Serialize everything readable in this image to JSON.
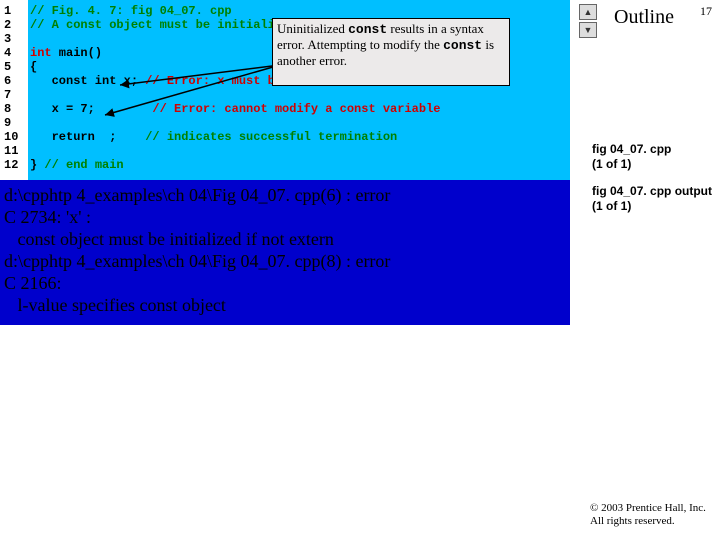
{
  "page_number": "17",
  "outline_title": "Outline",
  "nav": {
    "prev": "▲",
    "next": "▼"
  },
  "line_numbers": "1\n2\n3\n4\n5\n6\n7\n8\n9\n10\n11\n12",
  "code": {
    "l1": "// Fig. 4. 7: fig 04_07. cpp",
    "l2": "// A const object must be initialized",
    "l3": "",
    "l4_intmain": "int",
    "l4_main": " main()",
    "l5": "{",
    "l6_pre": "   const int x; ",
    "l6_err": "// Error: x must be initialized",
    "l7": "",
    "l8_pre": "   x = 7;        ",
    "l8_err": "// Error: cannot modify a const variable",
    "l9": "",
    "l10_pre": "   return  ;    ",
    "l10_note": "// indicates successful termination",
    "l11": "",
    "l12": "} ",
    "l12_note": "// end main"
  },
  "callout": {
    "part1": "Uninitialized ",
    "const1": "const",
    "part2": " results in a syntax error. Attempting to modify the ",
    "const2": "const",
    "part3": " is another error."
  },
  "output_text": "d:\\cpphtp 4_examples\\ch 04\\Fig 04_07. cpp(6) : error\nC 2734: 'x' :\n   const object must be initialized if not extern\nd:\\cpphtp 4_examples\\ch 04\\Fig 04_07. cpp(8) : error\nC 2166:\n   l-value specifies const object",
  "side_labels": {
    "source": "fig 04_07. cpp\n(1 of 1)",
    "output": "fig 04_07. cpp output (1 of 1)"
  },
  "copyright": "© 2003 Prentice Hall, Inc.\nAll rights reserved."
}
